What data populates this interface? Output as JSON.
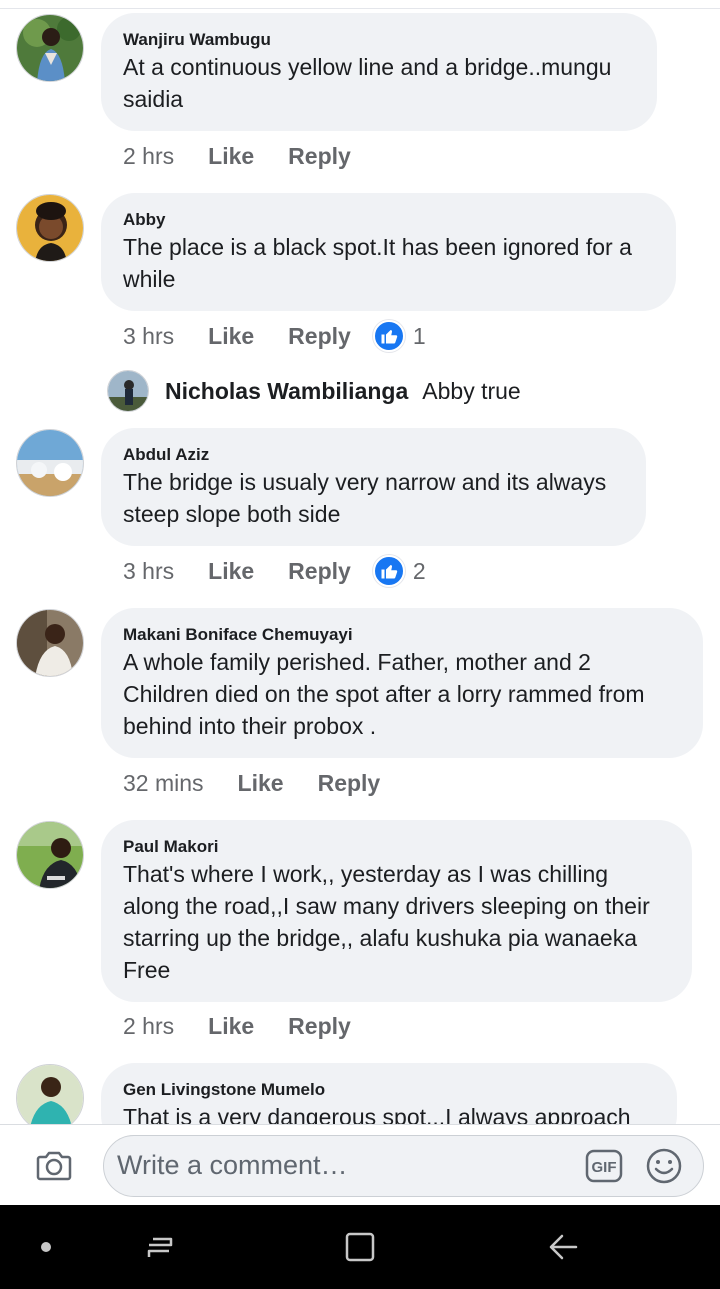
{
  "comments": [
    {
      "author": "Wanjiru Wambugu",
      "lines": [
        "At a continuous yellow line and a bridge..mungu",
        "saidia"
      ],
      "time": "2 hrs",
      "like": "Like",
      "reply": "Reply"
    },
    {
      "author": "Abby",
      "lines": [
        "The place is a black spot.It has been ignored for a",
        "while"
      ],
      "time": "3 hrs",
      "like": "Like",
      "reply": "Reply",
      "reactions": "1"
    },
    {
      "author": "Abdul Aziz",
      "lines": [
        "The bridge is usualy very narrow and its always",
        "steep slope both side"
      ],
      "time": "3 hrs",
      "like": "Like",
      "reply": "Reply",
      "reactions": "2"
    },
    {
      "author": "Makani Boniface Chemuyayi",
      "lines": [
        "A whole family perished. Father, mother and 2",
        "Children died on the spot after a lorry rammed from",
        "behind into their probox ."
      ],
      "time": "32 mins",
      "like": "Like",
      "reply": "Reply"
    },
    {
      "author": "Paul Makori",
      "lines": [
        "That's where I work,, yesterday as I was chilling",
        "along the road,,I saw many drivers sleeping on their",
        "starring up the bridge,, alafu kushuka pia wanaeka",
        "Free"
      ],
      "time": "2 hrs",
      "like": "Like",
      "reply": "Reply"
    },
    {
      "author": "Gen Livingstone Mumelo",
      "lines": [
        "That is a very dangerous  spot...I always approach"
      ]
    }
  ],
  "reply": {
    "author": "Nicholas Wambilianga",
    "text": "Abby true"
  },
  "composer": {
    "placeholder": "Write a comment…",
    "gif_label": "GIF"
  },
  "icons": {
    "camera": "camera-icon",
    "gif": "gif-icon",
    "emoji": "smiley-icon",
    "like_reaction": "thumbs-up-icon",
    "nav_dot": "dot-icon",
    "nav_recents": "recent-apps-icon",
    "nav_home": "home-square-icon",
    "nav_back": "back-arrow-icon"
  },
  "colors": {
    "accent": "#1877f2",
    "bubble": "#f0f2f5",
    "meta": "#65676b",
    "navbar": "#000000"
  }
}
